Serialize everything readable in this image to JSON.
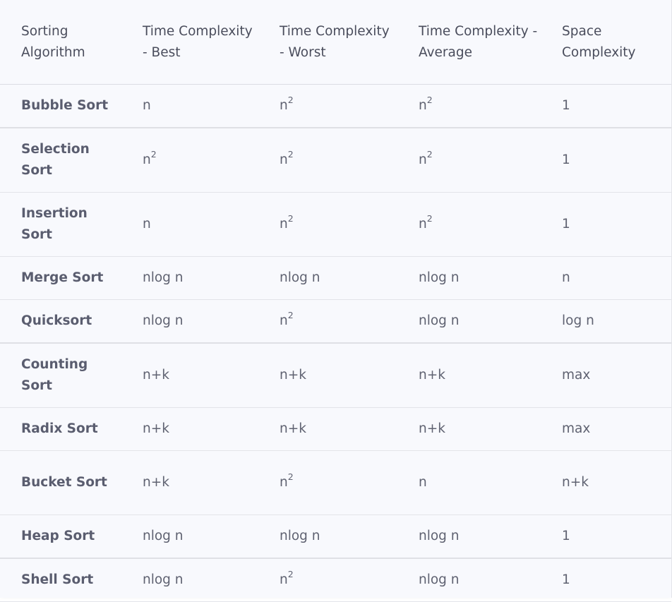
{
  "table": {
    "headers": [
      "Sorting Algorithm",
      "Time Complexity - Best",
      "Time Complexity - Worst",
      "Time Complexity - Average",
      "Space Complexity"
    ],
    "rows": [
      {
        "algorithm": "Bubble Sort",
        "best": {
          "base": "n",
          "exp": ""
        },
        "worst": {
          "base": "n",
          "exp": "2"
        },
        "average": {
          "base": "n",
          "exp": "2"
        },
        "space": "1"
      },
      {
        "algorithm": "Selection Sort",
        "best": {
          "base": "n",
          "exp": "2"
        },
        "worst": {
          "base": "n",
          "exp": "2"
        },
        "average": {
          "base": "n",
          "exp": "2"
        },
        "space": "1"
      },
      {
        "algorithm": "Insertion Sort",
        "best": {
          "base": "n",
          "exp": ""
        },
        "worst": {
          "base": "n",
          "exp": "2"
        },
        "average": {
          "base": "n",
          "exp": "2"
        },
        "space": "1"
      },
      {
        "algorithm": "Merge Sort",
        "best": {
          "base": "nlog n",
          "exp": ""
        },
        "worst": {
          "base": "nlog n",
          "exp": ""
        },
        "average": {
          "base": "nlog n",
          "exp": ""
        },
        "space": "n"
      },
      {
        "algorithm": "Quicksort",
        "best": {
          "base": "nlog n",
          "exp": ""
        },
        "worst": {
          "base": "n",
          "exp": "2"
        },
        "average": {
          "base": "nlog n",
          "exp": ""
        },
        "space": "log n"
      },
      {
        "algorithm": "Counting Sort",
        "best": {
          "base": "n+k",
          "exp": ""
        },
        "worst": {
          "base": "n+k",
          "exp": ""
        },
        "average": {
          "base": "n+k",
          "exp": ""
        },
        "space": "max"
      },
      {
        "algorithm": "Radix Sort",
        "best": {
          "base": "n+k",
          "exp": ""
        },
        "worst": {
          "base": "n+k",
          "exp": ""
        },
        "average": {
          "base": "n+k",
          "exp": ""
        },
        "space": "max"
      },
      {
        "algorithm": "Bucket Sort",
        "best": {
          "base": "n+k",
          "exp": ""
        },
        "worst": {
          "base": "n",
          "exp": "2"
        },
        "average": {
          "base": "n",
          "exp": ""
        },
        "space": "n+k"
      },
      {
        "algorithm": "Heap Sort",
        "best": {
          "base": "nlog n",
          "exp": ""
        },
        "worst": {
          "base": "nlog n",
          "exp": ""
        },
        "average": {
          "base": "nlog n",
          "exp": ""
        },
        "space": "1"
      },
      {
        "algorithm": "Shell Sort",
        "best": {
          "base": "nlog n",
          "exp": ""
        },
        "worst": {
          "base": "n",
          "exp": "2"
        },
        "average": {
          "base": "nlog n",
          "exp": ""
        },
        "space": "1"
      }
    ]
  }
}
